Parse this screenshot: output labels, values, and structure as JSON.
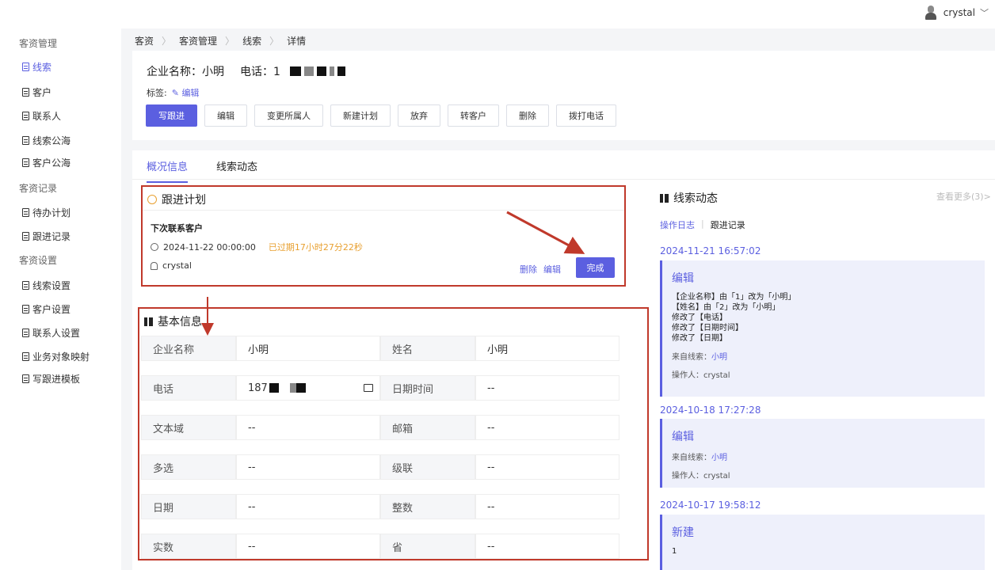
{
  "header": {
    "username": "crystal"
  },
  "sidebar": {
    "groups": [
      {
        "label": "客资管理",
        "items": [
          "线索",
          "客户",
          "联系人",
          "线索公海",
          "客户公海"
        ]
      },
      {
        "label": "客资记录",
        "items": [
          "待办计划",
          "跟进记录"
        ]
      },
      {
        "label": "客资设置",
        "items": [
          "线索设置",
          "客户设置",
          "联系人设置",
          "业务对象映射",
          "写跟进模板"
        ]
      }
    ],
    "active": "线索"
  },
  "breadcrumb": [
    "客资",
    "客资管理",
    "线索",
    "详情"
  ],
  "detail": {
    "company_label": "企业名称：小明",
    "phone_label": "电话：1",
    "tags_label": "标签:",
    "tags_edit": "编辑",
    "actions": [
      "写跟进",
      "编辑",
      "变更所属人",
      "新建计划",
      "放弃",
      "转客户",
      "删除",
      "拨打电话"
    ]
  },
  "tabs": [
    "概况信息",
    "线索动态"
  ],
  "plan": {
    "title": "跟进计划",
    "name": "下次联系客户",
    "time": "2024-11-22 00:00:00",
    "overdue": "已过期17小时27分22秒",
    "owner": "crystal",
    "delete": "删除",
    "edit": "编辑",
    "done": "完成"
  },
  "basic": {
    "title": "基本信息",
    "rows": [
      [
        {
          "label": "企业名称",
          "value": "小明"
        },
        {
          "label": "姓名",
          "value": "小明"
        }
      ],
      [
        {
          "label": "电话",
          "value": "187"
        },
        {
          "label": "日期时间",
          "value": "--"
        }
      ],
      [
        {
          "label": "文本域",
          "value": "--"
        },
        {
          "label": "邮箱",
          "value": "--"
        }
      ],
      [
        {
          "label": "多选",
          "value": "--"
        },
        {
          "label": "级联",
          "value": "--"
        }
      ],
      [
        {
          "label": "日期",
          "value": "--"
        },
        {
          "label": "整数",
          "value": "--"
        }
      ],
      [
        {
          "label": "实数",
          "value": "--"
        },
        {
          "label": "省",
          "value": "--"
        }
      ]
    ]
  },
  "dynamics": {
    "title": "线索动态",
    "see_more": "查看更多(3)>",
    "tab_ops": "操作日志",
    "tab_records": "跟进记录",
    "logs": [
      {
        "date": "2024-11-21 16:57:02",
        "title": "编辑",
        "lines": [
          "【企业名称】由「1」改为「小明」",
          "【姓名】由「2」改为「小明」",
          "修改了【电话】",
          "修改了【日期时间】",
          "修改了【日期】"
        ],
        "source_label": "来自线索：",
        "source": "小明",
        "operator": "操作人：crystal"
      },
      {
        "date": "2024-10-18 17:27:28",
        "title": "编辑",
        "lines": [],
        "source_label": "来自线索：",
        "source": "小明",
        "operator": "操作人：crystal"
      },
      {
        "date": "2024-10-17 19:58:12",
        "title": "新建",
        "lines": [
          "1"
        ],
        "source_label": "",
        "source": "",
        "operator": ""
      }
    ]
  },
  "colors": {
    "accent": "#5b5fe0",
    "warning": "#e8a030",
    "annotation": "#c0392b"
  }
}
